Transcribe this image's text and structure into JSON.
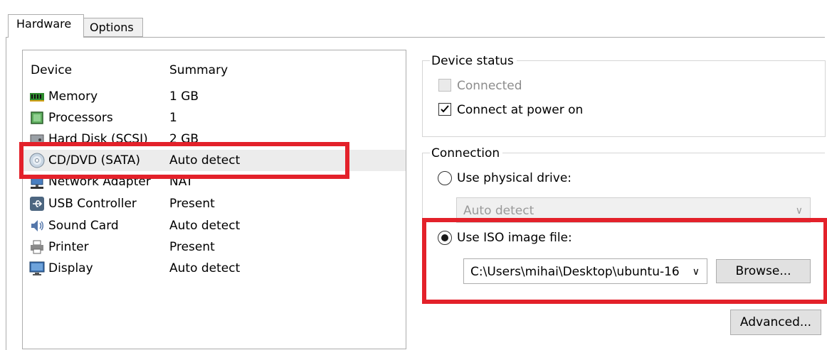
{
  "tabs": [
    {
      "label": "Hardware",
      "active": true
    },
    {
      "label": "Options",
      "active": false
    }
  ],
  "device_list": {
    "columns": [
      "Device",
      "Summary"
    ],
    "rows": [
      {
        "icon": "memory-icon",
        "name": "Memory",
        "summary": "1 GB"
      },
      {
        "icon": "processor-icon",
        "name": "Processors",
        "summary": "1"
      },
      {
        "icon": "hard-disk-icon",
        "name": "Hard Disk (SCSI)",
        "summary": "2 GB"
      },
      {
        "icon": "cd-dvd-icon",
        "name": "CD/DVD (SATA)",
        "summary": "Auto detect",
        "selected": true
      },
      {
        "icon": "network-adapter-icon",
        "name": "Network Adapter",
        "summary": "NAT"
      },
      {
        "icon": "usb-icon",
        "name": "USB Controller",
        "summary": "Present"
      },
      {
        "icon": "sound-card-icon",
        "name": "Sound Card",
        "summary": "Auto detect"
      },
      {
        "icon": "printer-icon",
        "name": "Printer",
        "summary": "Present"
      },
      {
        "icon": "display-icon",
        "name": "Display",
        "summary": "Auto detect"
      }
    ]
  },
  "device_status": {
    "title": "Device status",
    "connected": {
      "label": "Connected",
      "checked": false,
      "enabled": false
    },
    "connect_at_power_on": {
      "label": "Connect at power on",
      "checked": true
    }
  },
  "connection": {
    "title": "Connection",
    "physical_drive": {
      "label": "Use physical drive:",
      "selected": false,
      "value": "Auto detect"
    },
    "iso_image": {
      "label": "Use ISO image file:",
      "selected": true,
      "value": "C:\\Users\\mihai\\Desktop\\ubuntu-16"
    },
    "browse_label": "Browse...",
    "advanced_label": "Advanced..."
  },
  "colors": {
    "highlight": "#e3212a",
    "selection": "#ececec"
  }
}
